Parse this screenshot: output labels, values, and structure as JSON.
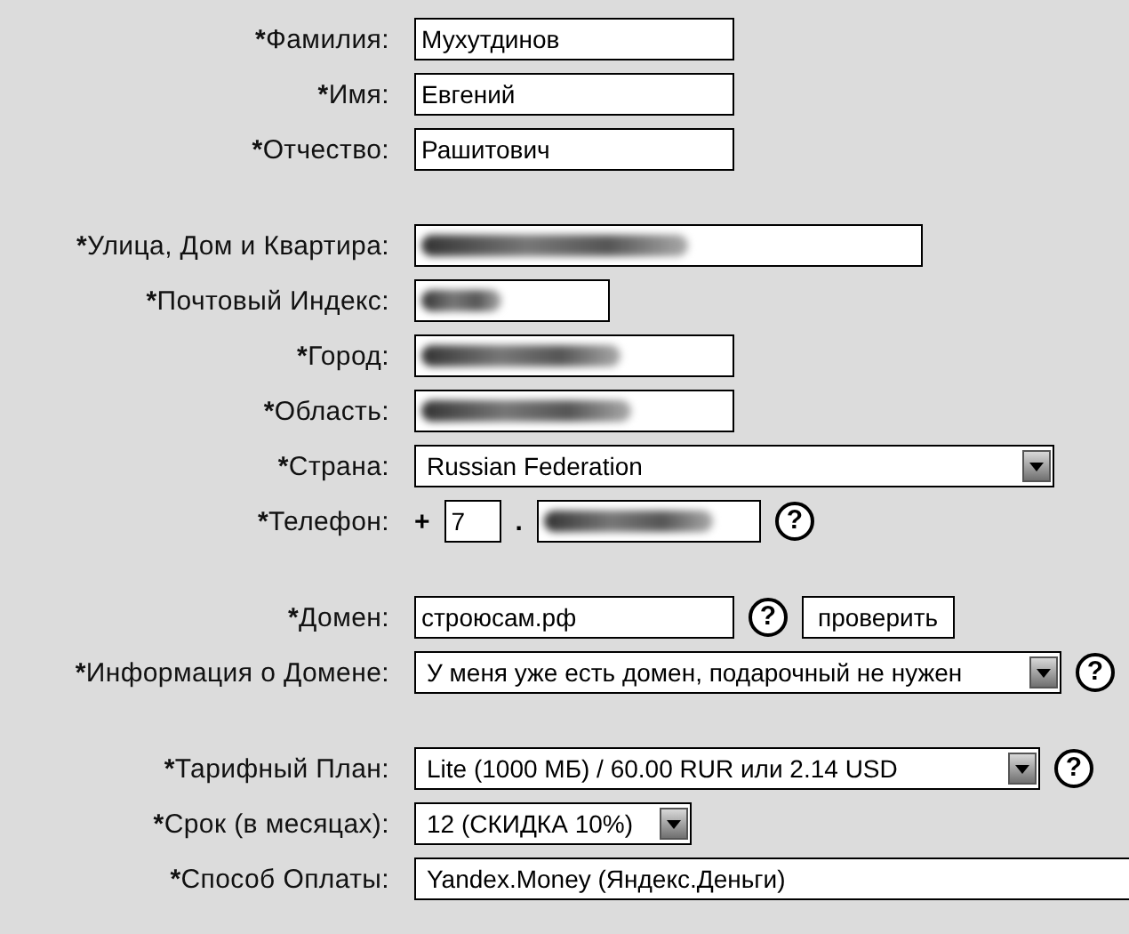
{
  "sections": [
    {
      "rows": [
        {
          "mark": "*",
          "label": "Фамилия:",
          "controls": [
            {
              "kind": "input",
              "value": "Мухутдинов"
            }
          ]
        },
        {
          "mark": "*",
          "label": "Имя:",
          "controls": [
            {
              "kind": "input",
              "value": "Евгений"
            }
          ]
        },
        {
          "mark": "*",
          "label": "Отчество:",
          "controls": [
            {
              "kind": "input",
              "value": "Рашитович"
            }
          ]
        }
      ]
    },
    {
      "rows": [
        {
          "mark": "*",
          "label": "Улица, Дом и Квартира:",
          "controls": [
            {
              "kind": "blurred-input"
            }
          ]
        },
        {
          "mark": "*",
          "label": "Почтовый Индекс:",
          "controls": [
            {
              "kind": "blurred-input"
            }
          ]
        },
        {
          "mark": "*",
          "label": "Город:",
          "controls": [
            {
              "kind": "blurred-input"
            }
          ]
        },
        {
          "mark": "*",
          "label": "Область:",
          "controls": [
            {
              "kind": "blurred-input"
            }
          ]
        },
        {
          "mark": "*",
          "label": "Страна:",
          "controls": [
            {
              "kind": "select",
              "value": "Russian Federation"
            }
          ]
        },
        {
          "mark": "*",
          "label": "Телефон:",
          "controls": [
            {
              "kind": "text",
              "text": "+"
            },
            {
              "kind": "input",
              "value": "7"
            },
            {
              "kind": "text",
              "text": "."
            },
            {
              "kind": "blurred-input"
            },
            {
              "kind": "help",
              "label": "?"
            }
          ]
        }
      ]
    },
    {
      "rows": [
        {
          "mark": "*",
          "label": "Домен:",
          "controls": [
            {
              "kind": "input",
              "value": "строюсам.рф"
            },
            {
              "kind": "help",
              "label": "?"
            },
            {
              "kind": "button",
              "label": "проверить"
            }
          ]
        },
        {
          "mark": "*",
          "label": "Информация о Домене:",
          "controls": [
            {
              "kind": "select",
              "value": "У меня уже есть домен, подарочный не нужен"
            },
            {
              "kind": "help",
              "label": "?"
            }
          ]
        }
      ]
    },
    {
      "rows": [
        {
          "mark": "*",
          "label": "Тарифный План:",
          "controls": [
            {
              "kind": "select",
              "value": "Lite (1000 МБ) / 60.00 RUR или 2.14 USD"
            },
            {
              "kind": "help",
              "label": "?"
            }
          ]
        },
        {
          "mark": "*",
          "label": "Срок (в месяцах):",
          "controls": [
            {
              "kind": "select",
              "value": "12 (СКИДКА 10%)"
            }
          ]
        },
        {
          "mark": "*",
          "label": "Способ Оплаты:",
          "controls": [
            {
              "kind": "cut-select",
              "value": "Yandex.Money (Яндекс.Деньги)"
            }
          ]
        }
      ]
    }
  ]
}
